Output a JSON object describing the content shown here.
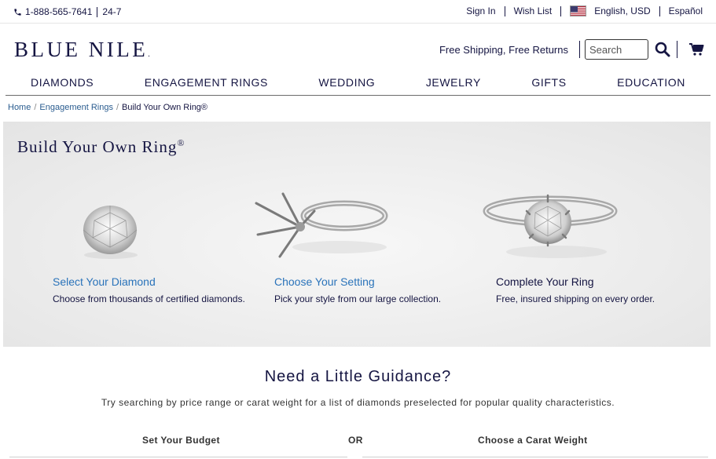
{
  "utility": {
    "phone": "1-888-565-7641",
    "hours": "24-7",
    "sign_in": "Sign In",
    "wish_list": "Wish List",
    "locale": "English, USD",
    "language": "Español"
  },
  "header": {
    "logo": "BLUE NILE",
    "shipping": "Free Shipping, Free Returns",
    "search_placeholder": "Search"
  },
  "nav": [
    "DIAMONDS",
    "ENGAGEMENT RINGS",
    "WEDDING",
    "JEWELRY",
    "GIFTS",
    "EDUCATION"
  ],
  "breadcrumb": {
    "home": "Home",
    "engagement": "Engagement Rings",
    "current": "Build Your Own Ring®"
  },
  "hero": {
    "title": "Build Your Own Ring",
    "title_mark": "®",
    "steps": [
      {
        "title": "Select Your Diamond",
        "desc": "Choose from thousands of certified diamonds."
      },
      {
        "title": "Choose Your Setting",
        "desc": "Pick your style from our large collection."
      },
      {
        "title": "Complete Your Ring",
        "desc": "Free, insured shipping on every order."
      }
    ]
  },
  "guidance": {
    "title": "Need a Little Guidance?",
    "subtitle": "Try searching by price range or carat weight for a list of diamonds preselected for popular quality characteristics.",
    "budget": "Set Your Budget",
    "or": "OR",
    "carat": "Choose a Carat Weight"
  },
  "colors": {
    "navy": "#151542",
    "link_blue": "#2a73ba",
    "hero_bg": "#ececec"
  }
}
